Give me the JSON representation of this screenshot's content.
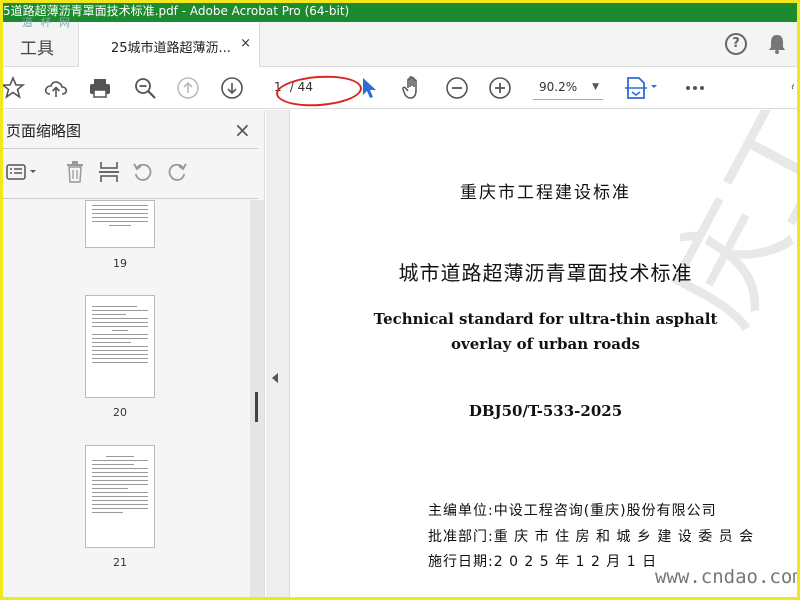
{
  "window": {
    "title": "5道路超薄沥青罩面技术标准.pdf - Adobe Acrobat Pro (64-bit)",
    "watermark_logo": "道 杯 网"
  },
  "tabs": {
    "tools_label": "工具",
    "doc_label": "25城市道路超薄沥...",
    "close_glyph": "×"
  },
  "header_icons": [
    "help-icon",
    "bell-icon"
  ],
  "toolbar": {
    "icons": [
      "star-icon",
      "upload-cloud-icon",
      "print-icon",
      "zoom-out-search-icon",
      "prev-page-icon",
      "next-page-icon",
      "select-cursor-icon",
      "hand-icon",
      "zoom-minus-icon",
      "zoom-plus-icon",
      "page-fit-icon",
      "more-icon"
    ],
    "current_page": "1",
    "total_pages": "/ 44",
    "zoom": "90.2%",
    "accent_color": "#2d6bd6",
    "annotation_color": "#d9261c"
  },
  "sidebar": {
    "title": "页面缩略图",
    "close_glyph": "×",
    "tool_icons": [
      "thumbnail-options-icon",
      "delete-icon",
      "insert-page-icon",
      "rotate-left-icon",
      "rotate-right-icon"
    ],
    "thumbnails": [
      {
        "label": "19"
      },
      {
        "label": "20"
      },
      {
        "label": "21"
      }
    ]
  },
  "document": {
    "header": "重庆市工程建设标准",
    "title": "城市道路超薄沥青罩面技术标准",
    "title_en_line1": "Technical standard for ultra-thin asphalt",
    "title_en_line2": "overlay of urban roads",
    "code": "DBJ50/T-533-2025",
    "editor": "主编单位:中设工程咨询(重庆)股份有限公司",
    "approver": "批准部门:重 庆 市 住 房 和 城 乡 建 设 委 员 会",
    "effective": "施行日期:2 0 2 5 年 1 2 月 1 日",
    "watermark": "庆工程建设",
    "site_watermark": "www.cndao.com"
  }
}
